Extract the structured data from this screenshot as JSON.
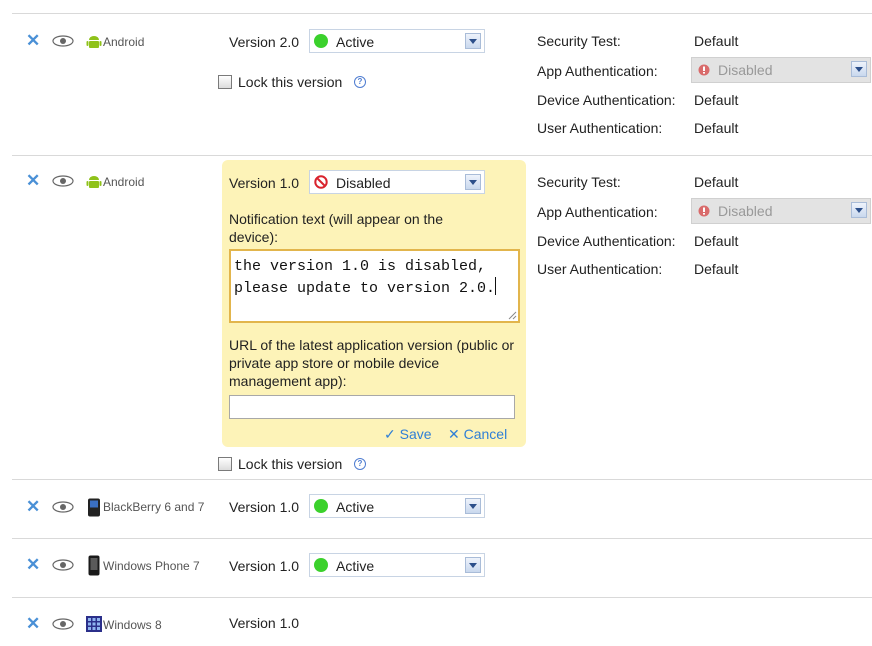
{
  "rows": [
    {
      "platform": "Android",
      "version_label": "Version 2.0",
      "status": "Active",
      "lock_label": "Lock this version",
      "props": [
        {
          "label": "Security Test:",
          "value": "Default"
        },
        {
          "label": "App Authentication:",
          "value": "Disabled"
        },
        {
          "label": "Device Authentication:",
          "value": "Default"
        },
        {
          "label": "User Authentication:",
          "value": "Default"
        }
      ]
    },
    {
      "platform": "Android",
      "version_label": "Version 1.0",
      "status": "Disabled",
      "lock_label": "Lock this version",
      "notification_label": "Notification text (will appear on the device):",
      "notification_value": "the version 1.0 is disabled,\nplease update to version 2.0.",
      "url_label": "URL of the latest application version (public or private app store or mobile device management app):",
      "url_value": "",
      "save_label": "Save",
      "cancel_label": "Cancel",
      "props": [
        {
          "label": "Security Test:",
          "value": "Default"
        },
        {
          "label": "App Authentication:",
          "value": "Disabled"
        },
        {
          "label": "Device Authentication:",
          "value": "Default"
        },
        {
          "label": "User Authentication:",
          "value": "Default"
        }
      ]
    },
    {
      "platform": "BlackBerry 6 and 7",
      "version_label": "Version 1.0",
      "status": "Active"
    },
    {
      "platform": "Windows Phone 7",
      "version_label": "Version 1.0",
      "status": "Active"
    },
    {
      "platform": "Windows 8",
      "version_label": "Version 1.0"
    }
  ],
  "icons": {
    "delete": "close-x-icon",
    "visibility": "eye-icon",
    "android": "android-icon",
    "blackberry": "blackberry-phone-icon",
    "windows_phone": "windows-phone-icon",
    "windows8": "windows8-tiles-icon",
    "help": "help-question-icon",
    "status_active": "green-dot-icon",
    "status_disabled": "red-no-entry-icon",
    "status_warning": "red-exclamation-icon",
    "checkmark": "check-icon"
  },
  "colors": {
    "active_green": "#3bd12c",
    "disabled_red": "#d9232d",
    "link_blue": "#2f7fd6",
    "panel_bg": "#fdf3b8",
    "textarea_border": "#e2b54c"
  }
}
